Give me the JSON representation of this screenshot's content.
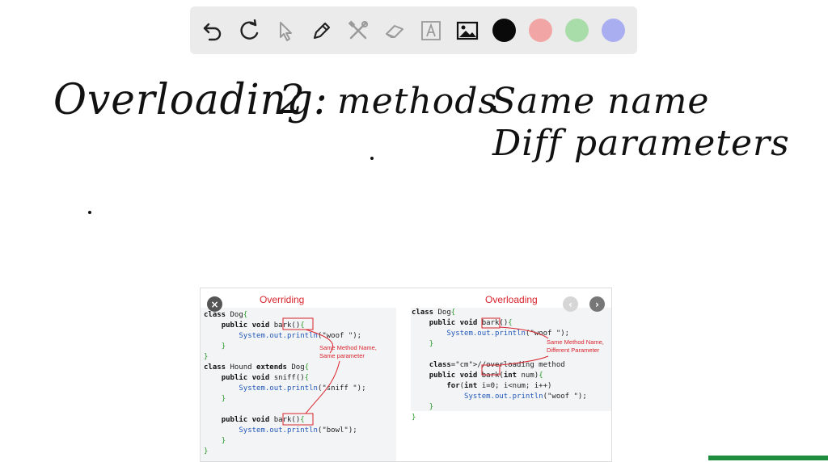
{
  "toolbar": {
    "tools": [
      {
        "name": "undo-icon"
      },
      {
        "name": "redo-icon"
      },
      {
        "name": "select-pointer-icon"
      },
      {
        "name": "pen-icon"
      },
      {
        "name": "tools-icon"
      },
      {
        "name": "eraser-icon"
      },
      {
        "name": "text-tool-icon"
      },
      {
        "name": "image-icon"
      }
    ],
    "colors": [
      "#0a0a0a",
      "#f2a5a5",
      "#a8dca8",
      "#a9aef0"
    ]
  },
  "canvas": {
    "line1_a": "Overloading:",
    "line1_b": "2",
    "line1_c": "methods",
    "line1_d": "Same name",
    "line2": "Diff parameters"
  },
  "slide": {
    "left_title": "Overriding",
    "right_title": "Overloading",
    "close_icon": "×",
    "prev_icon": "‹",
    "next_icon": "›",
    "left_note": "Same Method Name,\nSame parameter",
    "right_note": "Same Method Name,\nDifferent Parameter",
    "left_code": [
      "class Dog{",
      "    public void bark(){",
      "        System.out.println(\"woof \");",
      "    }",
      "}",
      "class Hound extends Dog{",
      "    public void sniff(){",
      "        System.out.println(\"sniff \");",
      "    }",
      "",
      "    public void bark(){",
      "        System.out.println(\"bowl\");",
      "    }",
      "}"
    ],
    "right_code": [
      "class Dog{",
      "    public void bark(){",
      "        System.out.println(\"woof \");",
      "    }",
      "",
      "    //overloading method",
      "    public void bark(int num){",
      "        for(int i=0; i<num; i++)",
      "            System.out.println(\"woof \");",
      "    }",
      "}"
    ]
  }
}
